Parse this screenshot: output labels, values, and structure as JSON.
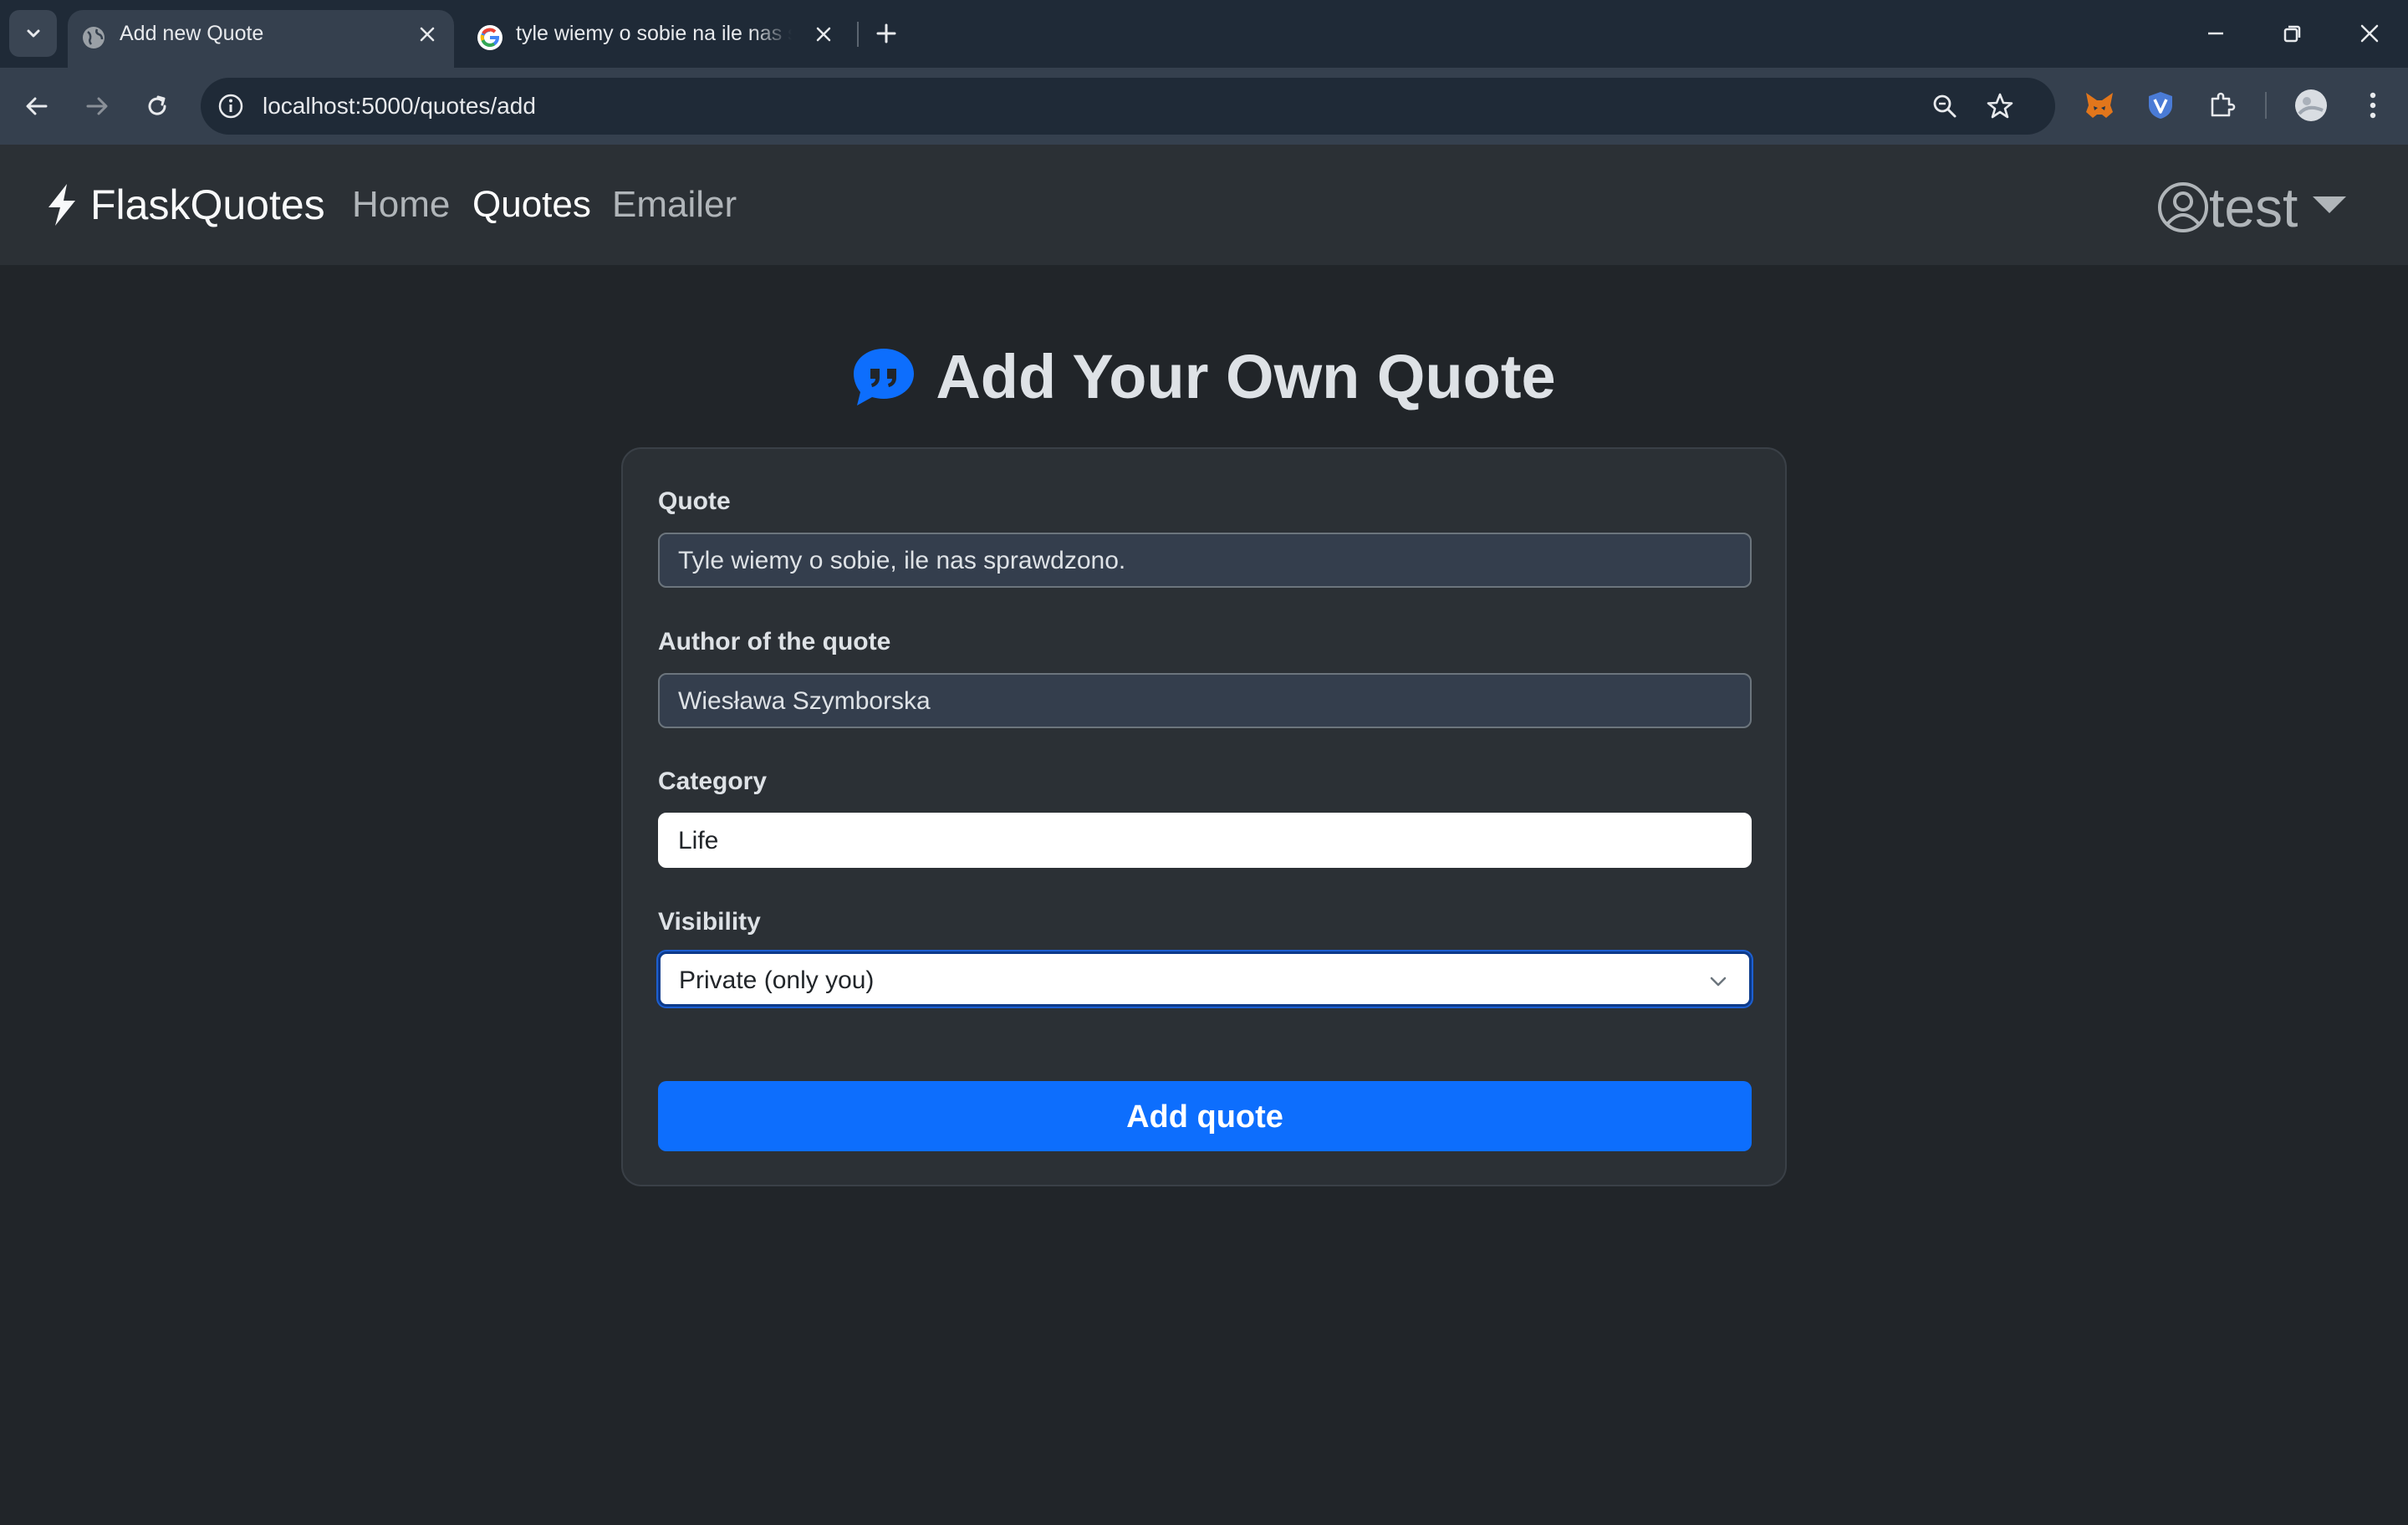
{
  "browser": {
    "tabs": [
      {
        "title": "Add new Quote",
        "active": true
      },
      {
        "title": "tyle wiemy o sobie na ile nas sprawdzono",
        "active": false
      }
    ],
    "url": "localhost:5000/quotes/add"
  },
  "navbar": {
    "brand": "FlaskQuotes",
    "links": [
      {
        "label": "Home",
        "active": false
      },
      {
        "label": "Quotes",
        "active": true
      },
      {
        "label": "Emailer",
        "active": false
      }
    ],
    "user": "test"
  },
  "page": {
    "title": "Add Your Own Quote"
  },
  "form": {
    "quote": {
      "label": "Quote",
      "value": "Tyle wiemy o sobie, ile nas sprawdzono."
    },
    "author": {
      "label": "Author of the quote",
      "value": "Wiesława Szymborska"
    },
    "category": {
      "label": "Category",
      "value": "Life"
    },
    "visibility": {
      "label": "Visibility",
      "selected": "Private (only you)"
    },
    "submit_label": "Add quote"
  },
  "colors": {
    "page_bg": "#212529",
    "navbar_bg": "#2b3035",
    "card_bg": "#2b3035",
    "primary": "#0d6efd"
  },
  "icons": {
    "brand": "lightning-bolt-icon",
    "heading": "quote-chat-icon",
    "user": "person-circle-icon"
  }
}
